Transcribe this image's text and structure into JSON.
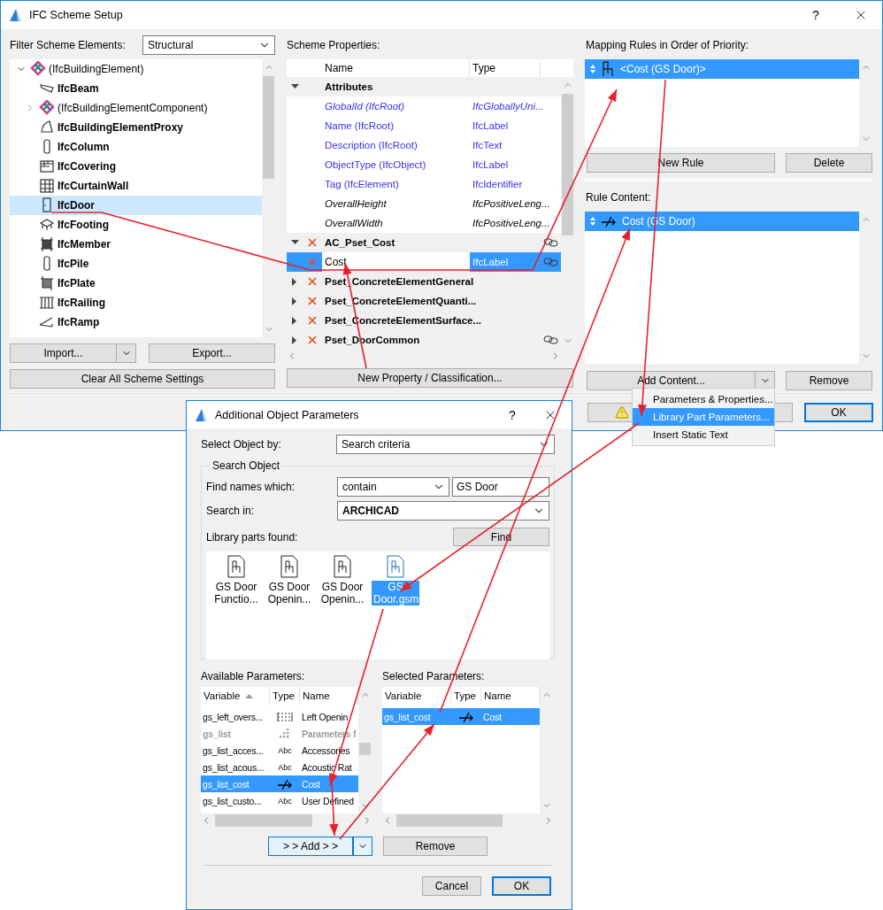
{
  "main_window": {
    "title": "IFC Scheme Setup",
    "help": "?"
  },
  "filter": {
    "label": "Filter Scheme Elements:",
    "value": "Structural"
  },
  "tree": [
    {
      "label": "(IfcBuildingElement)",
      "kind": "group",
      "expanded": true,
      "selected": false,
      "children": [
        {
          "label": "IfcBeam",
          "kind": "beam",
          "selected": false
        },
        {
          "label": "(IfcBuildingElementComponent)",
          "kind": "group",
          "expanded": false,
          "selected": false
        },
        {
          "label": "IfcBuildingElementProxy",
          "kind": "proxy",
          "selected": false
        },
        {
          "label": "IfcColumn",
          "kind": "column",
          "selected": false
        },
        {
          "label": "IfcCovering",
          "kind": "covering",
          "selected": false
        },
        {
          "label": "IfcCurtainWall",
          "kind": "curtainwall",
          "selected": false
        },
        {
          "label": "IfcDoor",
          "kind": "door",
          "selected": true
        },
        {
          "label": "IfcFooting",
          "kind": "footing",
          "selected": false
        },
        {
          "label": "IfcMember",
          "kind": "member",
          "selected": false
        },
        {
          "label": "IfcPile",
          "kind": "column",
          "selected": false
        },
        {
          "label": "IfcPlate",
          "kind": "plate",
          "selected": false
        },
        {
          "label": "IfcRailing",
          "kind": "railing",
          "selected": false
        },
        {
          "label": "IfcRamp",
          "kind": "ramp",
          "selected": false
        }
      ]
    }
  ],
  "left_buttons": {
    "import": "Import...",
    "export": "Export...",
    "clear": "Clear All Scheme Settings"
  },
  "scheme_properties": {
    "label": "Scheme Properties:",
    "columns": [
      "Name",
      "Type"
    ],
    "rows": [
      {
        "kind": "group",
        "name": "Attributes",
        "expanded": true,
        "removable": false,
        "linked": false,
        "selected": false
      },
      {
        "kind": "attribute",
        "name": "GlobalId (IfcRoot)",
        "type": "IfcGloballyUni...",
        "color": "#3b2fe6",
        "italic": true,
        "selected": false
      },
      {
        "kind": "attribute",
        "name": "Name (IfcRoot)",
        "type": "IfcLabel",
        "color": "#3b2fe6",
        "italic": false,
        "selected": false
      },
      {
        "kind": "attribute",
        "name": "Description (IfcRoot)",
        "type": "IfcText",
        "color": "#3b2fe6",
        "italic": false,
        "selected": false
      },
      {
        "kind": "attribute",
        "name": "ObjectType (IfcObject)",
        "type": "IfcLabel",
        "color": "#3b2fe6",
        "italic": false,
        "selected": false
      },
      {
        "kind": "attribute",
        "name": "Tag (IfcElement)",
        "type": "IfcIdentifier",
        "color": "#3b2fe6",
        "italic": false,
        "selected": false
      },
      {
        "kind": "attribute",
        "name": "OverallHeight",
        "type": "IfcPositiveLeng...",
        "color": "#000000",
        "italic": true,
        "selected": false
      },
      {
        "kind": "attribute",
        "name": "OverallWidth",
        "type": "IfcPositiveLeng...",
        "color": "#000000",
        "italic": true,
        "selected": false
      },
      {
        "kind": "group",
        "name": "AC_Pset_Cost",
        "expanded": true,
        "removable": true,
        "linked": true,
        "selected": false
      },
      {
        "kind": "property",
        "name": "Cost",
        "type": "IfcLabel",
        "removable": true,
        "linked": true,
        "selected": true
      },
      {
        "kind": "group",
        "name": "Pset_ConcreteElementGeneral",
        "expanded": false,
        "removable": true,
        "linked": false,
        "selected": false
      },
      {
        "kind": "group",
        "name": "Pset_ConcreteElementQuanti...",
        "expanded": false,
        "removable": true,
        "linked": false,
        "selected": false
      },
      {
        "kind": "group",
        "name": "Pset_ConcreteElementSurface...",
        "expanded": false,
        "removable": true,
        "linked": false,
        "selected": false
      },
      {
        "kind": "group",
        "name": "Pset_DoorCommon",
        "expanded": false,
        "removable": true,
        "linked": true,
        "selected": false
      }
    ]
  },
  "new_property_button": "New Property / Classification...",
  "mapping_rules": {
    "label": "Mapping Rules in Order of Priority:",
    "rules": [
      {
        "text": "<Cost (GS Door)>",
        "selected": true
      }
    ],
    "new_rule": "New Rule",
    "delete": "Delete"
  },
  "rule_content": {
    "label": "Rule Content:",
    "items": [
      {
        "text": "Cost (GS Door)",
        "selected": true
      }
    ],
    "add": "Add Content...",
    "remove": "Remove"
  },
  "footer": {
    "ok": "OK"
  },
  "add_content_menu": [
    {
      "label": "Parameters & Properties...",
      "selected": false
    },
    {
      "label": "Library Part Parameters...",
      "selected": true
    },
    {
      "label": "Insert Static Text",
      "selected": false
    }
  ],
  "dialog": {
    "title": "Additional Object Parameters",
    "help": "?",
    "select_by": {
      "label": "Select Object by:",
      "value": "Search criteria"
    },
    "search": {
      "title": "Search Object",
      "find_label": "Find names which:",
      "match": "contain",
      "name": "GS Door",
      "search_in_label": "Search in:",
      "search_in": "ARCHICAD",
      "found_label": "Library parts found:",
      "find_button": "Find",
      "parts": [
        {
          "name": "GS Door Functio...",
          "selected": false
        },
        {
          "name": "GS Door Openin...",
          "selected": false
        },
        {
          "name": "GS Door Openin...",
          "selected": false
        },
        {
          "name": "GS Door.gsm",
          "selected": true
        }
      ]
    },
    "available": {
      "label": "Available Parameters:",
      "columns": [
        "Variable",
        "Type",
        "Name"
      ],
      "rows": [
        {
          "variable": "gs_left_overs...",
          "kind": "dimension",
          "name": "Left Openin",
          "disabled": false,
          "selected": false
        },
        {
          "variable": "gs_list",
          "kind": "grid",
          "name": "Parameters f",
          "disabled": true,
          "selected": false
        },
        {
          "variable": "gs_list_acces...",
          "kind": "text",
          "type": "Abc",
          "name": "Accessories",
          "disabled": false,
          "selected": false
        },
        {
          "variable": "gs_list_acous...",
          "kind": "text",
          "type": "Abc",
          "name": "Acoustic Rat",
          "disabled": false,
          "selected": false
        },
        {
          "variable": "gs_list_cost",
          "kind": "cost",
          "name": "Cost",
          "disabled": false,
          "selected": true
        },
        {
          "variable": "gs_list_custo...",
          "kind": "text",
          "type": "Abc",
          "name": "User Defined",
          "disabled": false,
          "selected": false
        }
      ]
    },
    "selected_params": {
      "label": "Selected Parameters:",
      "columns": [
        "Variable",
        "Type",
        "Name"
      ],
      "rows": [
        {
          "variable": "gs_list_cost",
          "kind": "cost",
          "name": "Cost",
          "selected": true
        }
      ]
    },
    "add_button": "> > Add > >",
    "remove_button": "Remove",
    "cancel": "Cancel",
    "ok": "OK"
  }
}
